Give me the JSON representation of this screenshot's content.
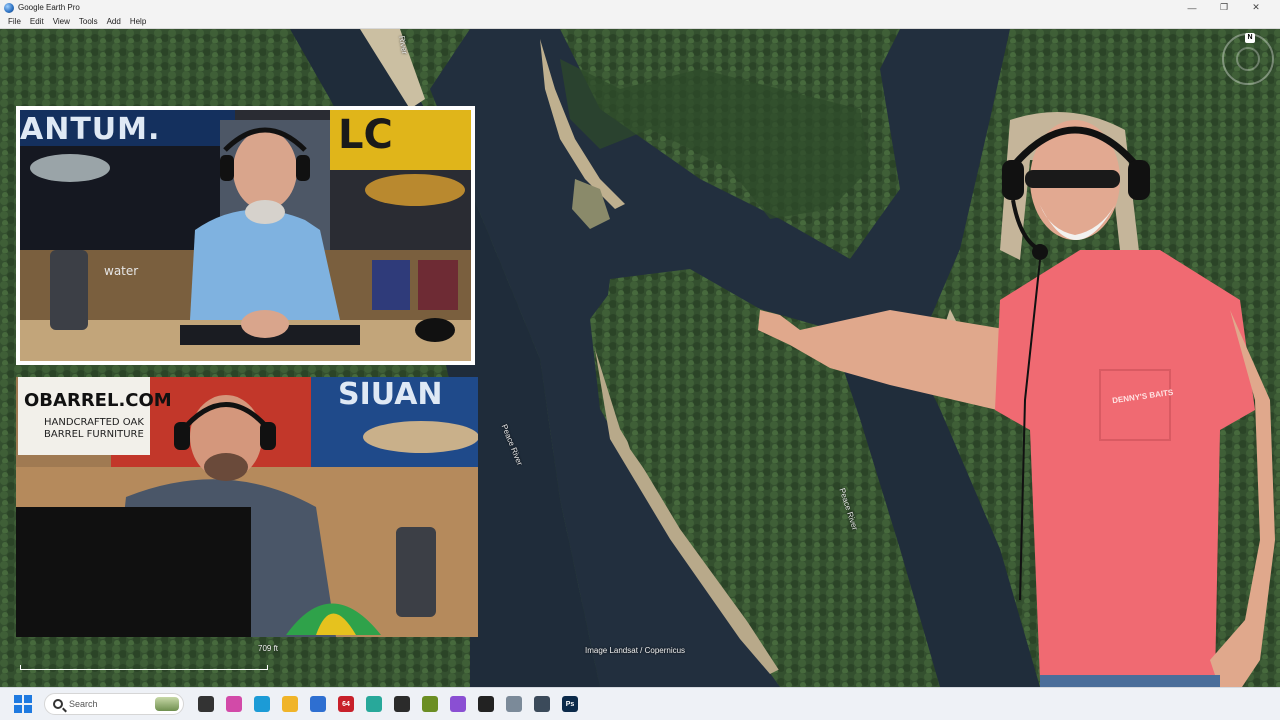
{
  "window": {
    "title": "Google Earth Pro",
    "controls": {
      "minimize": "—",
      "restore": "❐",
      "close": "✕"
    }
  },
  "menu": [
    "File",
    "Edit",
    "View",
    "Tools",
    "Add",
    "Help"
  ],
  "map": {
    "labels": {
      "river_top": "River",
      "river_mid": "Peace River",
      "river_right": "Peace River"
    },
    "attribution": "Image Landsat / Copernicus",
    "scale": "709 ft",
    "compass_letter": "N"
  },
  "cam1": {
    "sign_left": "ANTUM.",
    "sign_right": "LC",
    "watermark": "water"
  },
  "cam2": {
    "sign_main": "OBARREL.COM",
    "sign_sub_1": "HANDCRAFTED OAK",
    "sign_sub_2": "BARREL FURNITURE",
    "sign_right": "SIUAN"
  },
  "presenter": {
    "shirt_logo": "DENNY'S BAITS"
  },
  "taskbar": {
    "search_label": "Search",
    "icons": [
      {
        "name": "task-view-icon",
        "color": "#333333",
        "glyph": ""
      },
      {
        "name": "copilot-icon",
        "color": "#d24aa8",
        "glyph": ""
      },
      {
        "name": "edge-icon",
        "color": "#1c9bd6",
        "glyph": ""
      },
      {
        "name": "file-explorer-icon",
        "color": "#f0b428",
        "glyph": ""
      },
      {
        "name": "store-icon",
        "color": "#2e6fd1",
        "glyph": ""
      },
      {
        "name": "app-64-icon",
        "color": "#c8202a",
        "glyph": "64"
      },
      {
        "name": "app-teal-icon",
        "color": "#28a89a",
        "glyph": ""
      },
      {
        "name": "clapper-icon",
        "color": "#2b2b2b",
        "glyph": ""
      },
      {
        "name": "app-green-icon",
        "color": "#6b8e23",
        "glyph": ""
      },
      {
        "name": "app-purple-icon",
        "color": "#8a4fd3",
        "glyph": ""
      },
      {
        "name": "obs-icon",
        "color": "#222222",
        "glyph": ""
      },
      {
        "name": "app-gray-icon",
        "color": "#7b8a99",
        "glyph": ""
      },
      {
        "name": "screen-app-icon",
        "color": "#3b4a5a",
        "glyph": ""
      },
      {
        "name": "photoshop-icon",
        "color": "#0b2a4a",
        "glyph": "Ps"
      }
    ]
  }
}
